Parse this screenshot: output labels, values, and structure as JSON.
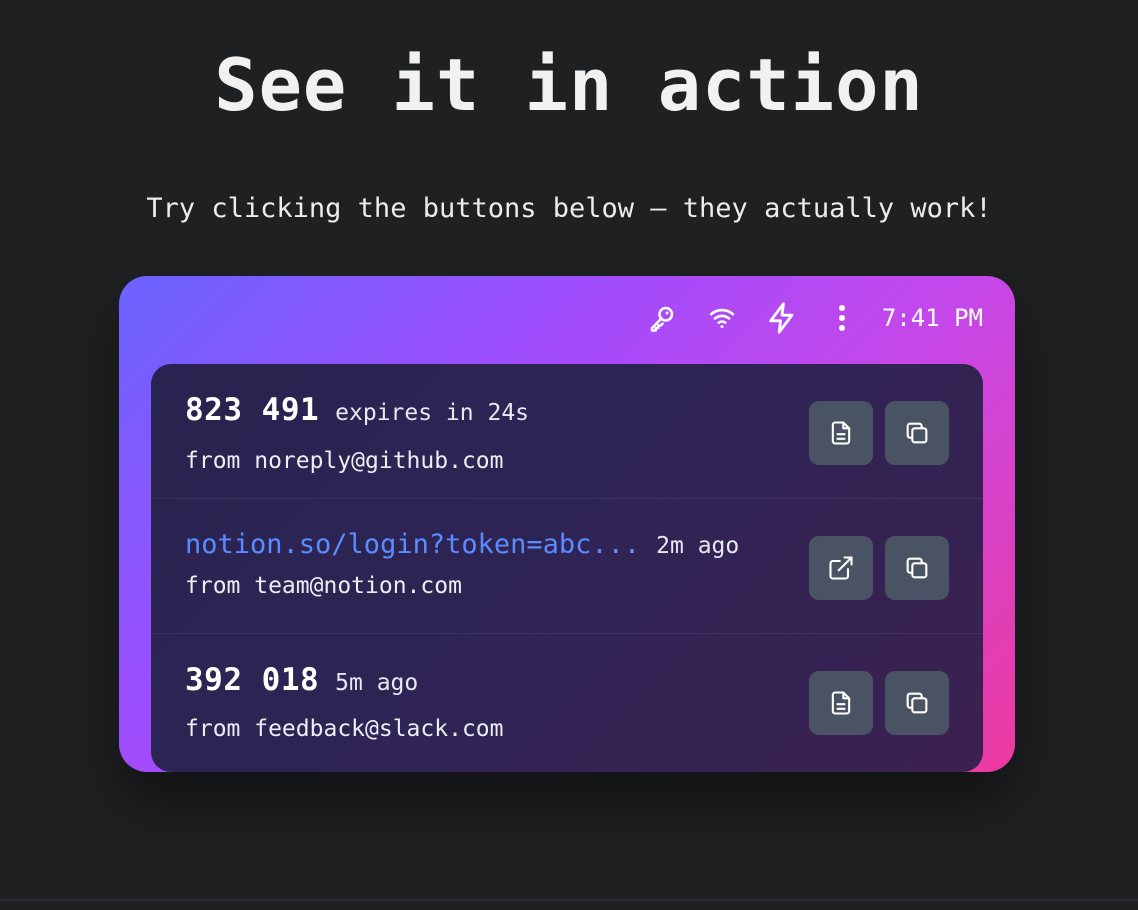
{
  "headline": "See it in action",
  "subtitle": "Try clicking the buttons below — they actually work!",
  "statusbar": {
    "icons": [
      "key-icon",
      "wifi-icon",
      "lightning-icon",
      "more-vertical-icon"
    ],
    "time": "7:41 PM"
  },
  "items": [
    {
      "primary": "823 491",
      "kind": "code",
      "meta": "expires in 24s",
      "from": "from noreply@github.com",
      "actions": [
        "document-icon",
        "copy-icon"
      ]
    },
    {
      "primary": "notion.so/login?token=abc...",
      "kind": "link",
      "meta": "2m ago",
      "from": "from team@notion.com",
      "actions": [
        "external-link-icon",
        "copy-icon"
      ]
    },
    {
      "primary": "392 018",
      "kind": "code",
      "meta": "5m ago",
      "from": "from feedback@slack.com",
      "actions": [
        "document-icon",
        "copy-icon"
      ]
    }
  ],
  "colors": {
    "background": "#1f2022",
    "gradient_start": "#6a63ff",
    "gradient_end": "#ee3a9e",
    "panel": "#2b2452",
    "button": "#4a5363",
    "link": "#5b8cff"
  }
}
